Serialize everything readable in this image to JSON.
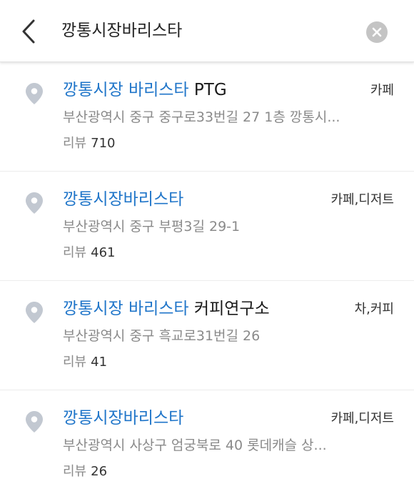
{
  "search": {
    "query": "깡통시장바리스타"
  },
  "icons": {
    "back": "back-arrow-icon",
    "clear": "clear-x-icon",
    "pin": "location-pin-icon"
  },
  "colors": {
    "highlight": "#1f75c9",
    "pin": "#c2c8d1",
    "clear_button": "#c4c4c4"
  },
  "results": [
    {
      "name_highlight": "깡통시장 바리스타",
      "name_rest": " PTG",
      "category": "카페",
      "address": "부산광역시 중구 중구로33번길 27 1층 깡통시...",
      "review_label": "리뷰",
      "review_count": "710"
    },
    {
      "name_highlight": "깡통시장바리스타",
      "name_rest": "",
      "category": "카페,디저트",
      "address": "부산광역시 중구 부평3길 29-1",
      "review_label": "리뷰",
      "review_count": "461"
    },
    {
      "name_highlight": "깡통시장 바리스타",
      "name_rest": " 커피연구소",
      "category": "차,커피",
      "address": "부산광역시 중구 흑교로31번길 26",
      "review_label": "리뷰",
      "review_count": "41"
    },
    {
      "name_highlight": "깡통시장바리스타",
      "name_rest": "",
      "category": "카페,디저트",
      "address": "부산광역시 사상구 엄궁북로 40 롯데캐슬 상...",
      "review_label": "리뷰",
      "review_count": "26"
    }
  ]
}
